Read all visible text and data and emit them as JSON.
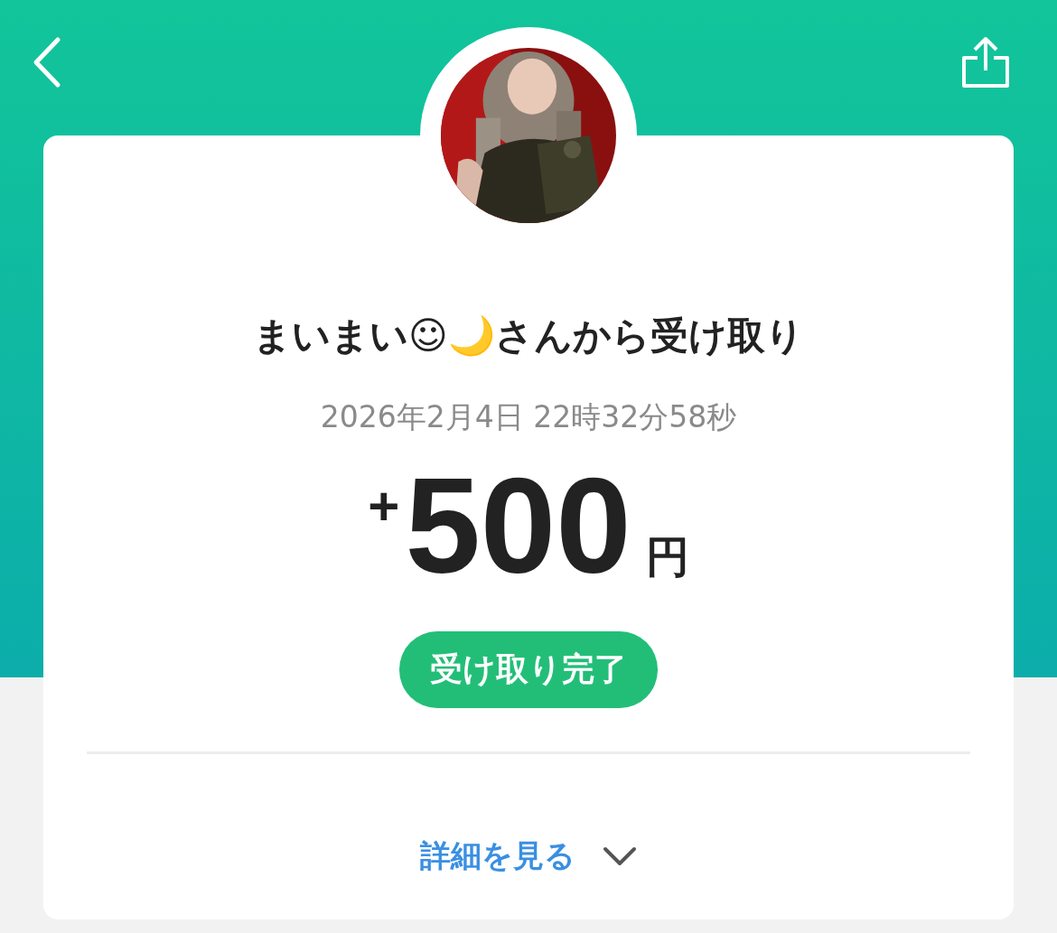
{
  "sender_title": "まいまい☺🌙さんから受け取り",
  "timestamp": "2026年2月4日 22時32分58秒",
  "amount": {
    "sign": "+",
    "value": "500",
    "unit": "円"
  },
  "status": {
    "label": "受け取り完了"
  },
  "details_toggle": {
    "label": "詳細を見る",
    "expanded": false
  }
}
